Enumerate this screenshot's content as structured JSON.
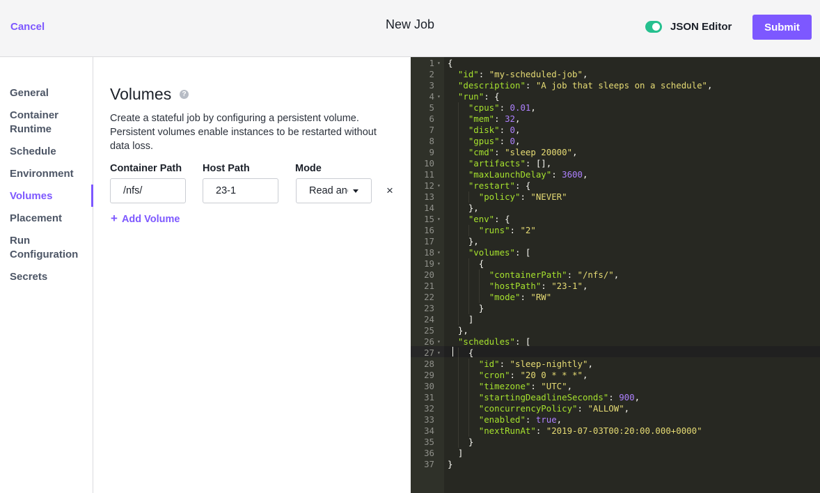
{
  "header": {
    "cancel_label": "Cancel",
    "title": "New Job",
    "toggle_label": "JSON Editor",
    "toggle_on": true,
    "submit_label": "Submit"
  },
  "sidebar": {
    "items": [
      {
        "label": "General"
      },
      {
        "label": "Container Runtime"
      },
      {
        "label": "Schedule"
      },
      {
        "label": "Environment"
      },
      {
        "label": "Volumes",
        "active": true
      },
      {
        "label": "Placement"
      },
      {
        "label": "Run Configuration"
      },
      {
        "label": "Secrets"
      }
    ]
  },
  "form": {
    "title": "Volumes",
    "help_icon": "?",
    "description": "Create a stateful job by configuring a persistent volume. Persistent volumes enable instances to be restarted without data loss.",
    "columns": {
      "container_path": "Container Path",
      "host_path": "Host Path",
      "mode": "Mode"
    },
    "volume": {
      "container_path": "/nfs/",
      "host_path": "23-1",
      "mode": "Read and Write"
    },
    "remove_icon": "×",
    "add_volume_label": "Add Volume"
  },
  "colors": {
    "accent": "#7d58ff",
    "toggle_on": "#26c08f",
    "editor_bg": "#272822"
  },
  "editor": {
    "active_line": 27,
    "lines": [
      [
        [
          "p",
          "{"
        ]
      ],
      [
        [
          "i",
          "  "
        ],
        [
          "k",
          "\"id\""
        ],
        [
          "p",
          ": "
        ],
        [
          "s",
          "\"my-scheduled-job\""
        ],
        [
          "p",
          ","
        ]
      ],
      [
        [
          "i",
          "  "
        ],
        [
          "k",
          "\"description\""
        ],
        [
          "p",
          ": "
        ],
        [
          "s",
          "\"A job that sleeps on a schedule\""
        ],
        [
          "p",
          ","
        ]
      ],
      [
        [
          "i",
          "  "
        ],
        [
          "k",
          "\"run\""
        ],
        [
          "p",
          ": {"
        ]
      ],
      [
        [
          "i",
          "    "
        ],
        [
          "k",
          "\"cpus\""
        ],
        [
          "p",
          ": "
        ],
        [
          "n",
          "0.01"
        ],
        [
          "p",
          ","
        ]
      ],
      [
        [
          "i",
          "    "
        ],
        [
          "k",
          "\"mem\""
        ],
        [
          "p",
          ": "
        ],
        [
          "n",
          "32"
        ],
        [
          "p",
          ","
        ]
      ],
      [
        [
          "i",
          "    "
        ],
        [
          "k",
          "\"disk\""
        ],
        [
          "p",
          ": "
        ],
        [
          "n",
          "0"
        ],
        [
          "p",
          ","
        ]
      ],
      [
        [
          "i",
          "    "
        ],
        [
          "k",
          "\"gpus\""
        ],
        [
          "p",
          ": "
        ],
        [
          "n",
          "0"
        ],
        [
          "p",
          ","
        ]
      ],
      [
        [
          "i",
          "    "
        ],
        [
          "k",
          "\"cmd\""
        ],
        [
          "p",
          ": "
        ],
        [
          "s",
          "\"sleep 20000\""
        ],
        [
          "p",
          ","
        ]
      ],
      [
        [
          "i",
          "    "
        ],
        [
          "k",
          "\"artifacts\""
        ],
        [
          "p",
          ": [],"
        ]
      ],
      [
        [
          "i",
          "    "
        ],
        [
          "k",
          "\"maxLaunchDelay\""
        ],
        [
          "p",
          ": "
        ],
        [
          "n",
          "3600"
        ],
        [
          "p",
          ","
        ]
      ],
      [
        [
          "i",
          "    "
        ],
        [
          "k",
          "\"restart\""
        ],
        [
          "p",
          ": {"
        ]
      ],
      [
        [
          "i",
          "      "
        ],
        [
          "k",
          "\"policy\""
        ],
        [
          "p",
          ": "
        ],
        [
          "s",
          "\"NEVER\""
        ]
      ],
      [
        [
          "i",
          "    "
        ],
        [
          "p",
          "},"
        ]
      ],
      [
        [
          "i",
          "    "
        ],
        [
          "k",
          "\"env\""
        ],
        [
          "p",
          ": {"
        ]
      ],
      [
        [
          "i",
          "      "
        ],
        [
          "k",
          "\"runs\""
        ],
        [
          "p",
          ": "
        ],
        [
          "s",
          "\"2\""
        ]
      ],
      [
        [
          "i",
          "    "
        ],
        [
          "p",
          "},"
        ]
      ],
      [
        [
          "i",
          "    "
        ],
        [
          "k",
          "\"volumes\""
        ],
        [
          "p",
          ": ["
        ]
      ],
      [
        [
          "i",
          "      "
        ],
        [
          "p",
          "{"
        ]
      ],
      [
        [
          "i",
          "        "
        ],
        [
          "k",
          "\"containerPath\""
        ],
        [
          "p",
          ": "
        ],
        [
          "s",
          "\"/nfs/\""
        ],
        [
          "p",
          ","
        ]
      ],
      [
        [
          "i",
          "        "
        ],
        [
          "k",
          "\"hostPath\""
        ],
        [
          "p",
          ": "
        ],
        [
          "s",
          "\"23-1\""
        ],
        [
          "p",
          ","
        ]
      ],
      [
        [
          "i",
          "        "
        ],
        [
          "k",
          "\"mode\""
        ],
        [
          "p",
          ": "
        ],
        [
          "s",
          "\"RW\""
        ]
      ],
      [
        [
          "i",
          "      "
        ],
        [
          "p",
          "}"
        ]
      ],
      [
        [
          "i",
          "    "
        ],
        [
          "p",
          "]"
        ]
      ],
      [
        [
          "i",
          "  "
        ],
        [
          "p",
          "},"
        ]
      ],
      [
        [
          "i",
          "  "
        ],
        [
          "k",
          "\"schedules\""
        ],
        [
          "p",
          ": ["
        ]
      ],
      [
        [
          "i",
          "    "
        ],
        [
          "p",
          "{"
        ]
      ],
      [
        [
          "i",
          "      "
        ],
        [
          "k",
          "\"id\""
        ],
        [
          "p",
          ": "
        ],
        [
          "s",
          "\"sleep-nightly\""
        ],
        [
          "p",
          ","
        ]
      ],
      [
        [
          "i",
          "      "
        ],
        [
          "k",
          "\"cron\""
        ],
        [
          "p",
          ": "
        ],
        [
          "s",
          "\"20 0 * * *\""
        ],
        [
          "p",
          ","
        ]
      ],
      [
        [
          "i",
          "      "
        ],
        [
          "k",
          "\"timezone\""
        ],
        [
          "p",
          ": "
        ],
        [
          "s",
          "\"UTC\""
        ],
        [
          "p",
          ","
        ]
      ],
      [
        [
          "i",
          "      "
        ],
        [
          "k",
          "\"startingDeadlineSeconds\""
        ],
        [
          "p",
          ": "
        ],
        [
          "n",
          "900"
        ],
        [
          "p",
          ","
        ]
      ],
      [
        [
          "i",
          "      "
        ],
        [
          "k",
          "\"concurrencyPolicy\""
        ],
        [
          "p",
          ": "
        ],
        [
          "s",
          "\"ALLOW\""
        ],
        [
          "p",
          ","
        ]
      ],
      [
        [
          "i",
          "      "
        ],
        [
          "k",
          "\"enabled\""
        ],
        [
          "p",
          ": "
        ],
        [
          "n",
          "true"
        ],
        [
          "p",
          ","
        ]
      ],
      [
        [
          "i",
          "      "
        ],
        [
          "k",
          "\"nextRunAt\""
        ],
        [
          "p",
          ": "
        ],
        [
          "s",
          "\"2019-07-03T00:20:00.000+0000\""
        ]
      ],
      [
        [
          "i",
          "    "
        ],
        [
          "p",
          "}"
        ]
      ],
      [
        [
          "i",
          "  "
        ],
        [
          "p",
          "]"
        ]
      ],
      [
        [
          "p",
          "}"
        ]
      ]
    ],
    "fold_lines": [
      1,
      4,
      12,
      15,
      18,
      19,
      26,
      27
    ]
  }
}
